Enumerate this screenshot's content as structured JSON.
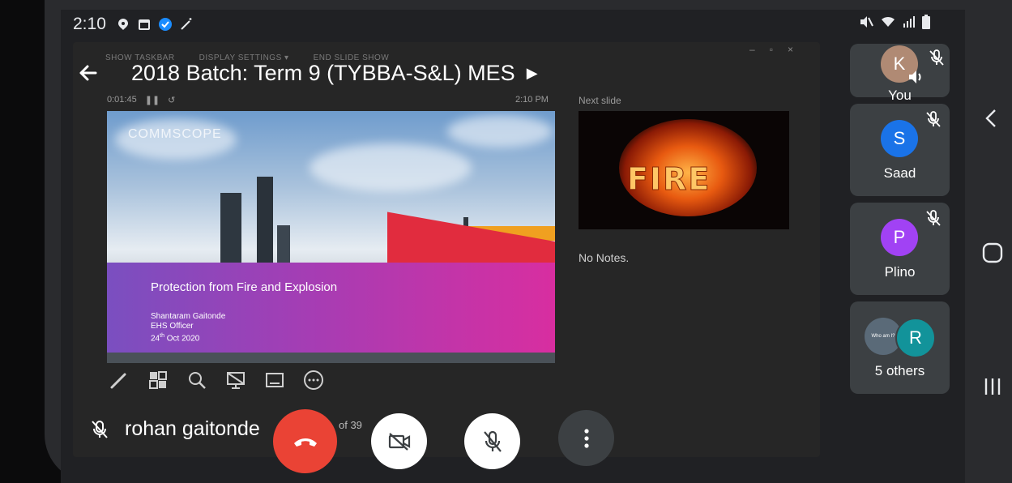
{
  "status_bar": {
    "time": "2:10"
  },
  "meeting": {
    "title": "2018 Batch: Term 9 (TYBBA-S&L) MES",
    "presenter_name": "rohan gaitonde"
  },
  "ppt_window": {
    "toolbar_items": [
      "SHOW TASKBAR",
      "DISPLAY SETTINGS ▾",
      "END SLIDE SHOW"
    ],
    "elapsed": "0:01:45",
    "clock": "2:10 PM",
    "next_slide_label": "Next slide",
    "notes": "No Notes.",
    "slide_counter": "of 39"
  },
  "current_slide": {
    "logo": "COMMSCOPE",
    "title": "Protection from Fire and Explosion",
    "author": "Shantaram Gaitonde",
    "role": "EHS Officer",
    "date_day": "24",
    "date_suffix": "th",
    "date_rest": " Oct 2020"
  },
  "next_slide": {
    "text": "FIRE"
  },
  "participants": [
    {
      "name": "You",
      "initial": "K",
      "color": "#b08a74"
    },
    {
      "name": "Saad",
      "initial": "S",
      "color": "#1a73e8"
    },
    {
      "name": "Plino",
      "initial": "P",
      "color": "#a142f4"
    },
    {
      "name": "5 others",
      "initial": "R",
      "color": "#12939a",
      "thumb_text": "Who am I?"
    }
  ],
  "colors": {
    "end_call": "#ea4335",
    "surface": "#3c4043",
    "background": "#202124"
  }
}
